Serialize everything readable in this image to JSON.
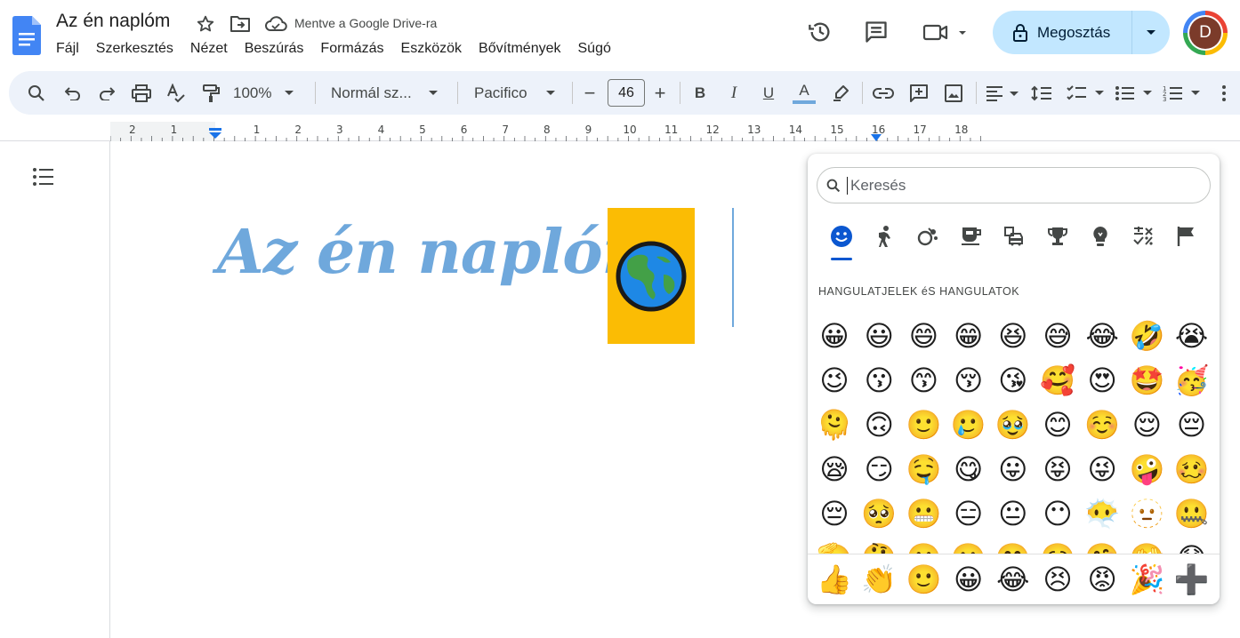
{
  "header": {
    "doc_title": "Az én naplóm",
    "saved_status": "Mentve a Google Drive-ra",
    "menu": [
      "Fájl",
      "Szerkesztés",
      "Nézet",
      "Beszúrás",
      "Formázás",
      "Eszközök",
      "Bővítmények",
      "Súgó"
    ],
    "share_label": "Megosztás",
    "avatar_letter": "D"
  },
  "toolbar": {
    "zoom": "100%",
    "style": "Normál sz...",
    "font": "Pacifico",
    "font_size": "46",
    "minus": "−",
    "plus": "+",
    "bold": "B",
    "italic": "I",
    "underline": "U",
    "text_color": "A"
  },
  "ruler": {
    "labels": [
      "2",
      "1",
      "1",
      "2",
      "3",
      "4",
      "5",
      "6",
      "7",
      "8",
      "9",
      "10",
      "11",
      "12",
      "13",
      "14",
      "15",
      "16",
      "17",
      "18"
    ]
  },
  "document": {
    "heading": "Az én naplóm",
    "image_emoji": "🌎"
  },
  "emoji_panel": {
    "search_placeholder": "Keresés",
    "categories": [
      "smiley-icon",
      "person-icon",
      "animal-icon",
      "food-icon",
      "travel-icon",
      "trophy-icon",
      "lightbulb-icon",
      "symbols-icon",
      "flag-icon"
    ],
    "section_label": "HANGULATJELEK éS HANGULATOK",
    "emojis": [
      "😀",
      "😃",
      "😄",
      "😁",
      "😆",
      "😅",
      "😂",
      "🤣",
      "😭",
      "😉",
      "😗",
      "😙",
      "😚",
      "😘",
      "🥰",
      "😍",
      "🤩",
      "🥳",
      "🫠",
      "🙃",
      "🙂",
      "🥲",
      "🥹",
      "😊",
      "☺️",
      "😌",
      "😔",
      "😪",
      "😏",
      "🤤",
      "😋",
      "😛",
      "😝",
      "😜",
      "🤪",
      "🥴",
      "😔",
      "🥺",
      "😬",
      "😑",
      "😐",
      "😶",
      "😶‍🌫️",
      "🫥",
      "🤐",
      "🫡",
      "🤔",
      "🤫",
      "🫢",
      "🤭",
      "🥱",
      "🤗",
      "🫣",
      "😱"
    ],
    "recent": [
      "👍",
      "👏",
      "🙂",
      "😀",
      "😂",
      "😣",
      "😡",
      "🎉",
      "➕"
    ]
  },
  "colors": {
    "heading": "#6fa8dc",
    "image_bg": "#fbbc04",
    "share_bg": "#c2e7ff",
    "toolbar_bg": "#edf2fa"
  }
}
